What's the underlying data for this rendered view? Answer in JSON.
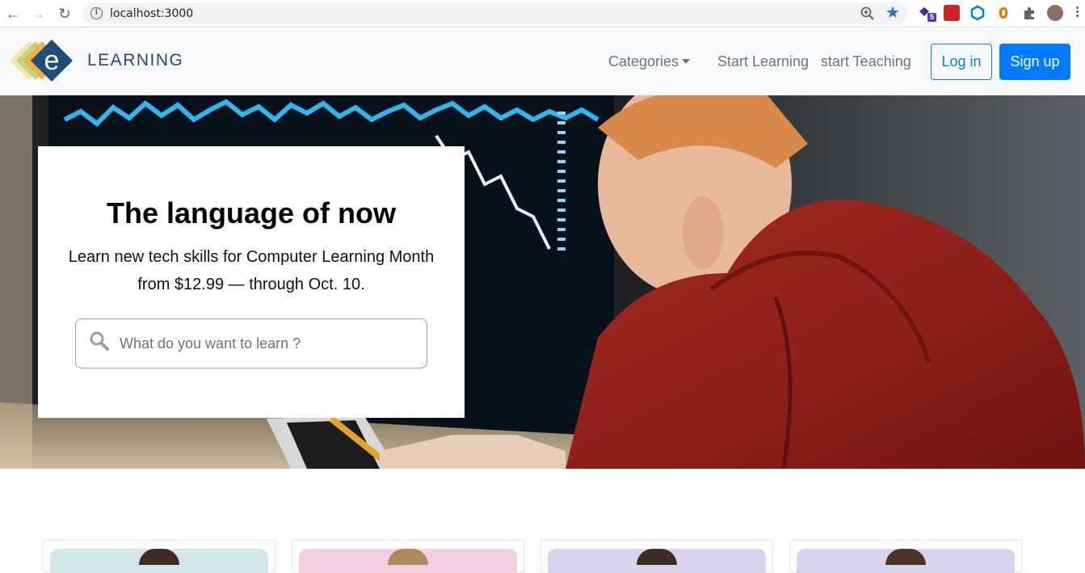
{
  "browser": {
    "url": "localhost:3000",
    "extension_badge": "5"
  },
  "navbar": {
    "logo_letter": "e",
    "logo_text": "LEARNING",
    "links": {
      "categories": "Categories",
      "start_learning": "Start Learning",
      "start_teaching": "start Teaching"
    },
    "login_label": "Log in",
    "signup_label": "Sign up",
    "colors": {
      "primary": "#007bff",
      "link": "#6c757d",
      "logo_navy": "#1e4e79"
    }
  },
  "hero": {
    "title": "The language of now",
    "subtitle": "Learn new tech skills for Computer Learning Month from $12.99 — through Oct. 10.",
    "search": {
      "placeholder": "What do you want to learn ?",
      "value": ""
    }
  },
  "icons": {
    "back": "arrow-left-icon",
    "forward": "arrow-right-icon",
    "reload": "reload-icon",
    "info": "info-icon",
    "zoom": "zoom-icon",
    "bookmark": "star-icon",
    "search": "search-icon",
    "caret": "caret-down-icon"
  }
}
